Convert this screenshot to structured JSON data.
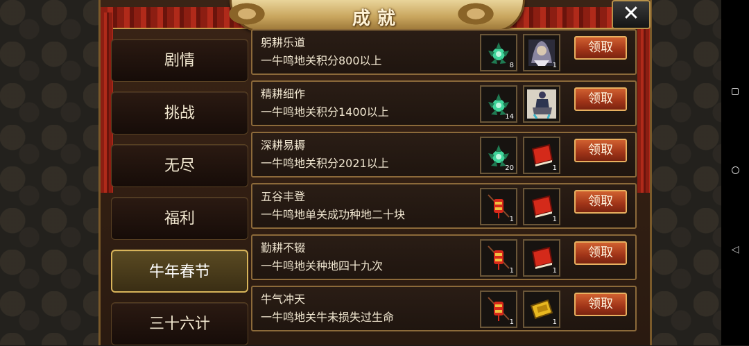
{
  "window": {
    "title": "成就"
  },
  "close": {
    "label": "✕"
  },
  "tabs": [
    {
      "label": "剧情",
      "active": false
    },
    {
      "label": "挑战",
      "active": false
    },
    {
      "label": "无尽",
      "active": false
    },
    {
      "label": "福利",
      "active": false
    },
    {
      "label": "牛年春节",
      "active": true
    },
    {
      "label": "三十六计",
      "active": false
    }
  ],
  "achievements": [
    {
      "title": "躬耕乐道",
      "desc": "一牛鸣地关积分800以上",
      "rewards": [
        {
          "icon": "green-herb-icon",
          "count": "8"
        },
        {
          "icon": "general-portrait-icon",
          "count": "1"
        }
      ],
      "button": "领取"
    },
    {
      "title": "精耕细作",
      "desc": "一牛鸣地关积分1400以上",
      "rewards": [
        {
          "icon": "green-herb-icon",
          "count": "14"
        },
        {
          "icon": "armored-rider-icon",
          "count": ""
        }
      ],
      "button": "领取"
    },
    {
      "title": "深耕易耨",
      "desc": "一牛鸣地关积分2021以上",
      "rewards": [
        {
          "icon": "green-herb-icon",
          "count": "20"
        },
        {
          "icon": "red-book-icon",
          "count": "1"
        }
      ],
      "button": "领取"
    },
    {
      "title": "五谷丰登",
      "desc": "一牛鸣地单关成功种地二十块",
      "rewards": [
        {
          "icon": "red-lantern-icon",
          "count": "1"
        },
        {
          "icon": "red-book-icon",
          "count": "1"
        }
      ],
      "button": "领取"
    },
    {
      "title": "勤耕不辍",
      "desc": "一牛鸣地关种地四十九次",
      "rewards": [
        {
          "icon": "red-lantern-icon",
          "count": "1"
        },
        {
          "icon": "red-book-icon",
          "count": "1"
        }
      ],
      "button": "领取"
    },
    {
      "title": "牛气冲天",
      "desc": "一牛鸣地关牛未损失过生命",
      "rewards": [
        {
          "icon": "red-lantern-icon",
          "count": "1"
        },
        {
          "icon": "gold-book-icon",
          "count": "1"
        }
      ],
      "button": "领取"
    }
  ],
  "system_nav": {
    "recents": "□",
    "home": "○",
    "back": "◁"
  }
}
